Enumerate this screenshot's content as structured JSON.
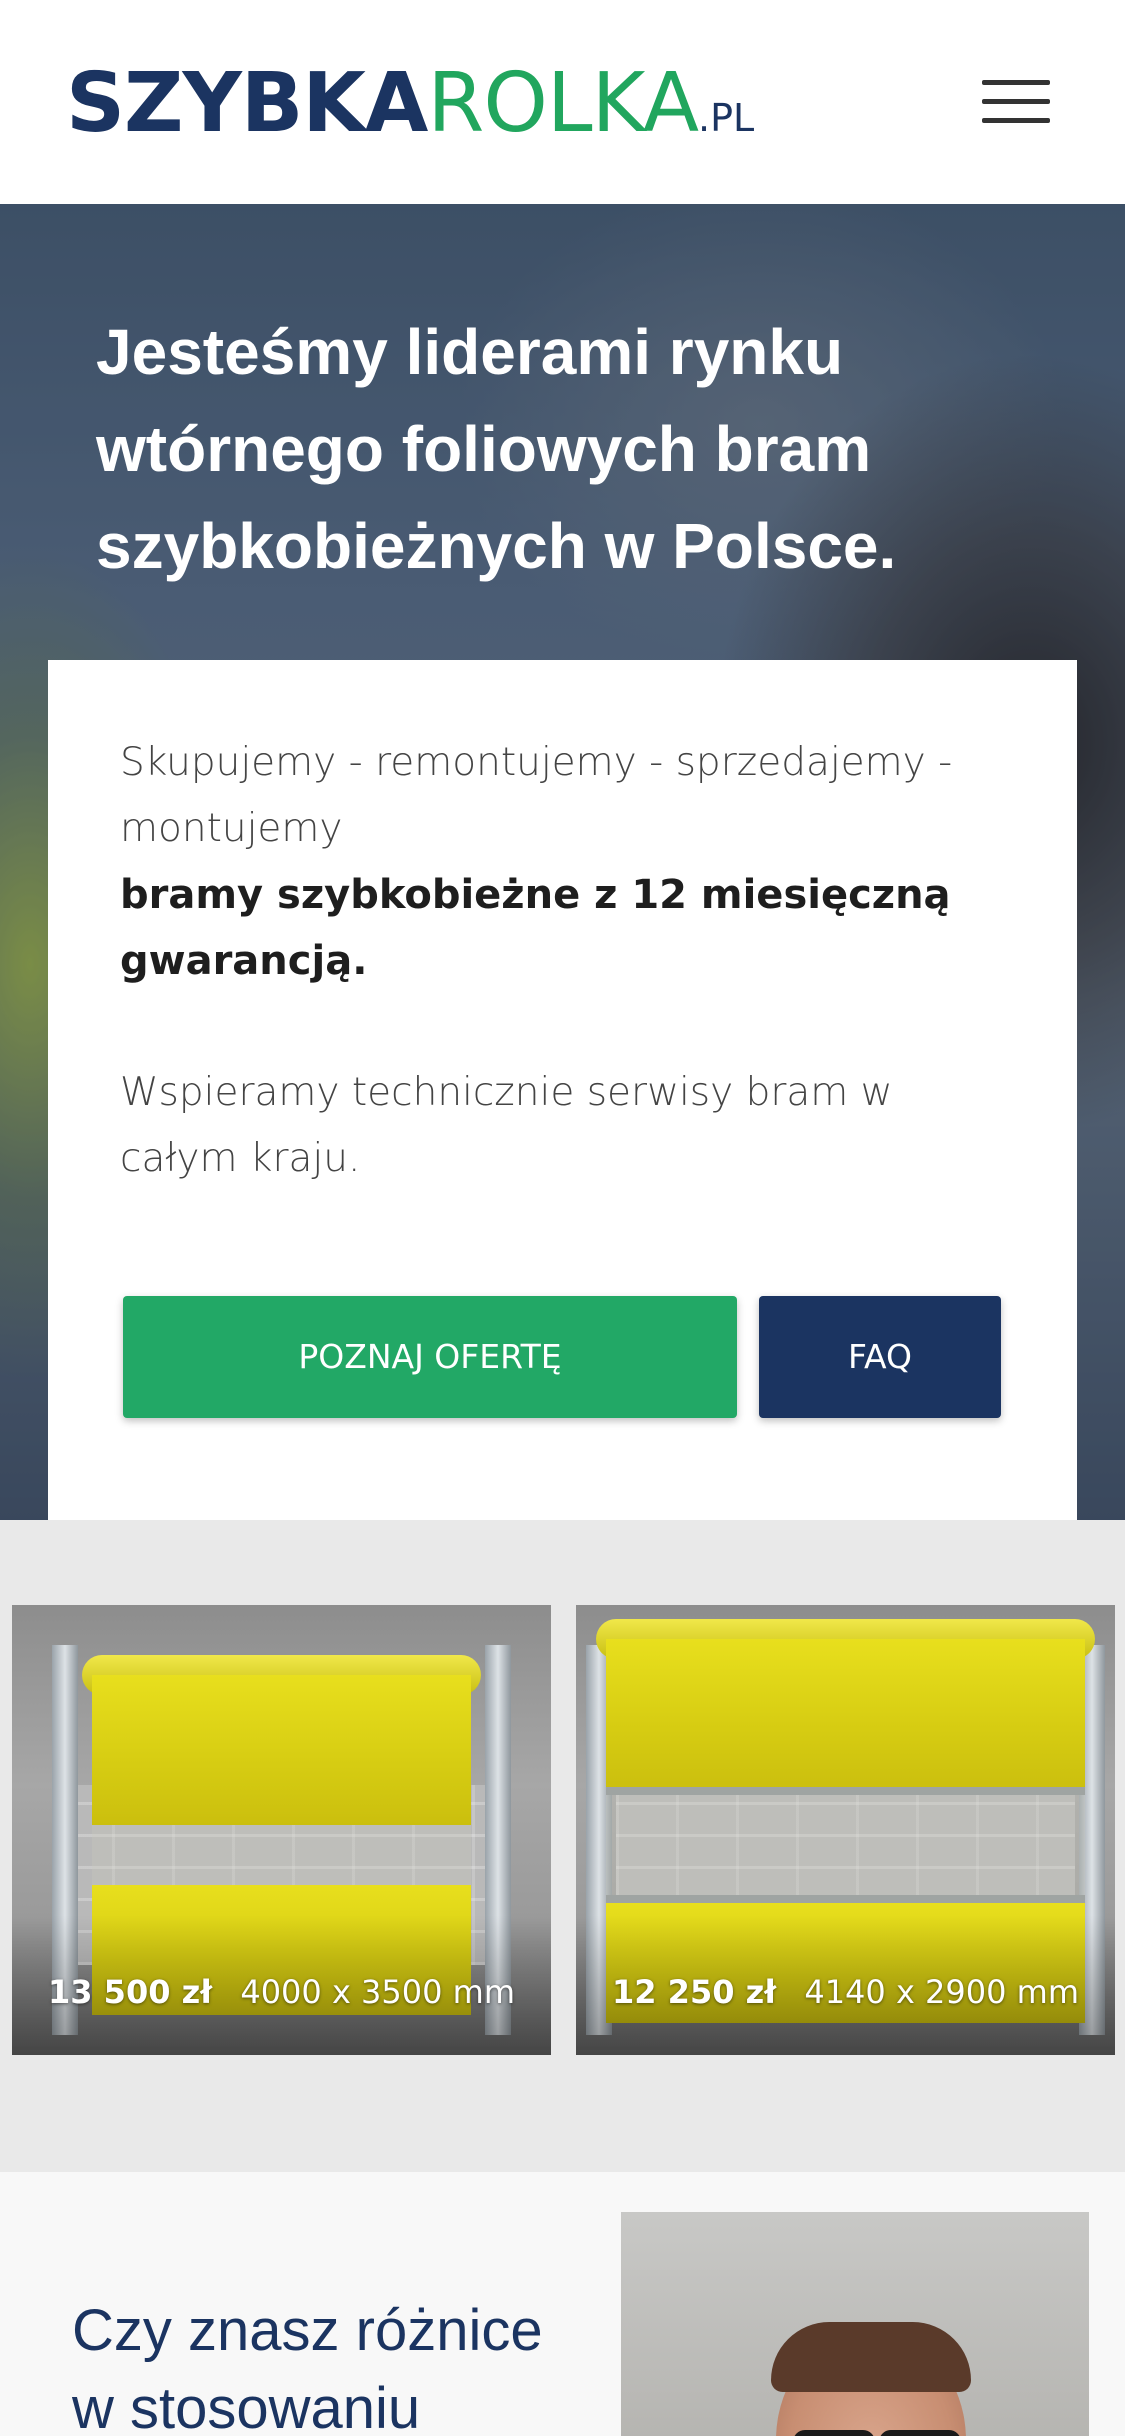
{
  "header": {
    "logo_part1": "SZYBKA",
    "logo_part2": "ROLKA",
    "logo_part3": ".PL",
    "menu_icon": "hamburger-menu-icon"
  },
  "hero": {
    "title": "Jesteśmy liderami rynku wtórnego foliowych bram szybkobieżnych w Polsce.",
    "line1": "Skupujemy - remontujemy - sprzedajemy - montujemy",
    "line2": "bramy szybkobieżne z 12 miesięczną gwarancją.",
    "line3": "Wspieramy technicznie serwisy bram w całym kraju.",
    "offer_button": "POZNAJ OFERTĘ",
    "faq_button": "FAQ"
  },
  "products": [
    {
      "price": "13 500 zł",
      "dimensions": "4000 x 3500 mm"
    },
    {
      "price": "12 250 zł",
      "dimensions": "4140 x 2900 mm"
    }
  ],
  "section": {
    "title": "Czy znasz różnice w stosowaniu"
  },
  "colors": {
    "brand_navy": "#1b3461",
    "brand_green": "#21a65e",
    "gate_yellow": "#e2d91a"
  }
}
